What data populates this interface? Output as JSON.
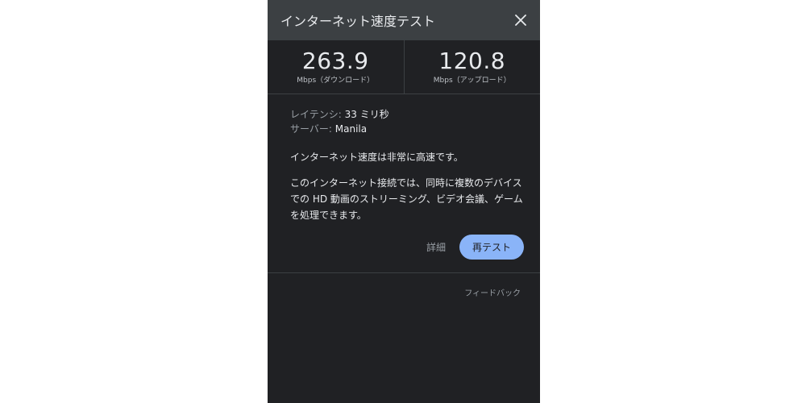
{
  "header": {
    "title": "インターネット速度テスト",
    "close_icon": "close-icon"
  },
  "speeds": {
    "download": {
      "value": "263.9",
      "unit": "Mbps（ダウンロード）"
    },
    "upload": {
      "value": "120.8",
      "unit": "Mbps（アップロード）"
    }
  },
  "stats": {
    "latency_label": "レイテンシ:",
    "latency_value": "33 ミリ秒",
    "server_label": "サーバー:",
    "server_value": "Manila"
  },
  "messages": {
    "summary": "インターネット速度は非常に高速です。",
    "detail_line1": "このインターネット接続では、同時に複数のデバイス",
    "detail_line2": "での HD 動画のストリーミング、ビデオ会議、ゲーム",
    "detail_line3": "を処理できます。"
  },
  "actions": {
    "details_label": "詳細",
    "retest_label": "再テスト"
  },
  "footer": {
    "feedback_label": "フィードバック"
  },
  "colors": {
    "panel_bg": "#202124",
    "header_bg": "#3c4043",
    "accent": "#8ab4f8"
  }
}
